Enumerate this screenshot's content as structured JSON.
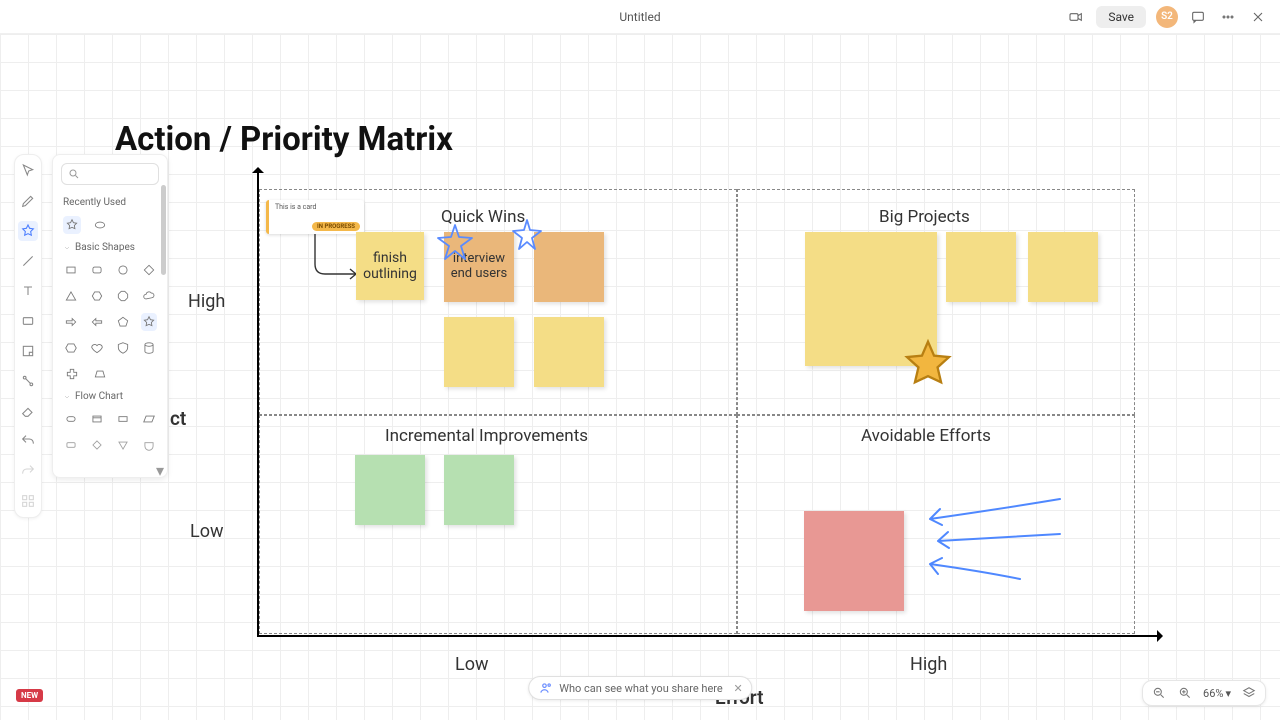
{
  "header": {
    "title": "Untitled",
    "save_label": "Save",
    "avatar": "S2"
  },
  "shape_panel": {
    "recently_used": "Recently Used",
    "basic_shapes": "Basic Shapes",
    "flow_chart": "Flow Chart"
  },
  "diagram": {
    "title": "Action / Priority Matrix",
    "quadrants": {
      "q1": "Quick Wins",
      "q2": "Big Projects",
      "q3": "Incremental Improvements",
      "q4": "Avoidable Efforts"
    },
    "y_high": "High",
    "y_low": "Low",
    "x_low": "Low",
    "x_high": "High",
    "y_title_partial": "ct",
    "x_title": "Effort",
    "notes": {
      "finish_outlining": "finish outlining",
      "interview_end_users": "interview end users"
    },
    "card": {
      "text": "This is a card",
      "tag": "IN PROGRESS"
    }
  },
  "footer": {
    "new_badge": "NEW",
    "share_text": "Who can see what you share here",
    "zoom_pct": "66%"
  }
}
